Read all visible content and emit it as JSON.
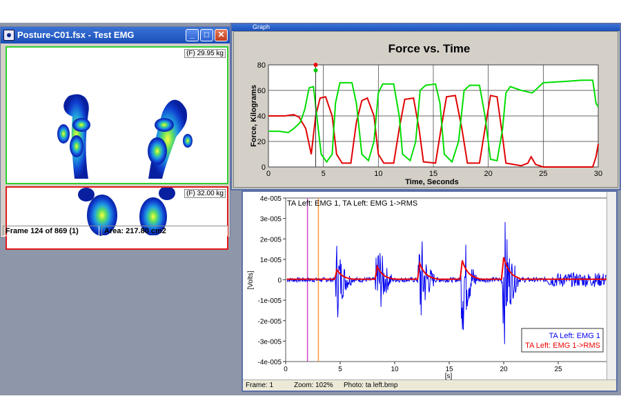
{
  "foot_window": {
    "title": "Posture-C01.fsx - Test  EMG",
    "minimize": "_",
    "maximize": "□",
    "close": "✕",
    "panel_top_label": "(F) 29.95 kg",
    "panel_bottom_label": "(F) 32.00 kg",
    "status_frame": "Frame 124 of 869 (1)",
    "status_area": "Area: 217.80 cm2"
  },
  "force_window": {
    "title": "Graph",
    "chart_data": {
      "type": "line",
      "title": "Force vs. Time",
      "xlabel": "Time, Seconds",
      "ylabel": "Force, Kilograms",
      "xlim": [
        0,
        30
      ],
      "ylim": [
        0,
        80
      ],
      "x_ticks": [
        "0",
        "5",
        "10",
        "15",
        "20",
        "25",
        "30"
      ],
      "y_ticks": [
        "0",
        "20",
        "40",
        "60",
        "80"
      ],
      "grid": true,
      "cursor_time": 4.3,
      "series": [
        {
          "color": "#e00000",
          "points": [
            [
              0,
              40
            ],
            [
              1.5,
              40
            ],
            [
              2.3,
              41
            ],
            [
              2.8,
              39
            ],
            [
              3.4,
              30
            ],
            [
              3.9,
              10
            ],
            [
              4.3,
              40
            ],
            [
              4.7,
              54
            ],
            [
              5.2,
              55
            ],
            [
              5.8,
              40
            ],
            [
              6.2,
              10
            ],
            [
              6.7,
              3
            ],
            [
              7.5,
              3
            ],
            [
              8,
              35
            ],
            [
              8.5,
              52
            ],
            [
              9,
              54
            ],
            [
              9.6,
              40
            ],
            [
              10,
              10
            ],
            [
              10.5,
              3
            ],
            [
              11.4,
              3
            ],
            [
              11.9,
              30
            ],
            [
              12.4,
              53
            ],
            [
              13.2,
              54
            ],
            [
              13.7,
              30
            ],
            [
              14.1,
              4
            ],
            [
              15.2,
              3
            ],
            [
              15.7,
              30
            ],
            [
              16.2,
              55
            ],
            [
              17,
              56
            ],
            [
              17.6,
              30
            ],
            [
              18.1,
              3
            ],
            [
              19.2,
              3
            ],
            [
              19.7,
              30
            ],
            [
              20.2,
              56
            ],
            [
              20.8,
              55
            ],
            [
              21.2,
              30
            ],
            [
              21.6,
              3
            ],
            [
              23,
              1
            ],
            [
              23.6,
              3
            ],
            [
              23.9,
              8
            ],
            [
              24.3,
              2
            ],
            [
              25,
              0
            ],
            [
              29.5,
              0
            ],
            [
              29.8,
              8
            ],
            [
              30,
              18
            ]
          ]
        },
        {
          "color": "#00dd00",
          "points": [
            [
              0,
              28
            ],
            [
              1,
              28
            ],
            [
              1.8,
              27
            ],
            [
              2.3,
              30
            ],
            [
              2.9,
              35
            ],
            [
              3.3,
              45
            ],
            [
              3.7,
              62
            ],
            [
              4.1,
              63
            ],
            [
              4.4,
              40
            ],
            [
              4.8,
              10
            ],
            [
              5.3,
              4
            ],
            [
              5.8,
              10
            ],
            [
              6.1,
              50
            ],
            [
              6.5,
              66
            ],
            [
              7.6,
              66
            ],
            [
              8,
              50
            ],
            [
              8.5,
              10
            ],
            [
              9.1,
              5
            ],
            [
              9.6,
              20
            ],
            [
              10,
              58
            ],
            [
              10.4,
              65
            ],
            [
              11.4,
              65
            ],
            [
              11.9,
              40
            ],
            [
              12.2,
              10
            ],
            [
              12.9,
              5
            ],
            [
              13.4,
              20
            ],
            [
              13.8,
              60
            ],
            [
              14.3,
              64
            ],
            [
              15.2,
              65
            ],
            [
              15.6,
              50
            ],
            [
              16,
              10
            ],
            [
              16.7,
              4
            ],
            [
              17.3,
              20
            ],
            [
              17.8,
              60
            ],
            [
              18.3,
              64
            ],
            [
              19.2,
              64
            ],
            [
              19.7,
              40
            ],
            [
              20.2,
              6
            ],
            [
              20.8,
              5
            ],
            [
              21.3,
              30
            ],
            [
              21.6,
              58
            ],
            [
              22,
              63
            ],
            [
              23,
              60
            ],
            [
              24,
              58
            ],
            [
              24.5,
              62
            ],
            [
              25,
              66
            ],
            [
              27,
              67
            ],
            [
              28.5,
              68
            ],
            [
              29.5,
              68
            ],
            [
              29.8,
              50
            ],
            [
              30,
              47
            ]
          ]
        }
      ]
    }
  },
  "emg_window": {
    "legend_top": "TA Left: EMG 1, TA Left: EMG 1->RMS",
    "ylabel": "[Volts]",
    "xlabel": "[s]",
    "x_ticks": [
      "0",
      "5",
      "10",
      "15",
      "20",
      "25",
      "30"
    ],
    "y_ticks": [
      "4e-005",
      "3e-005",
      "2e-005",
      "1e-005",
      "0",
      "-1e-005",
      "-2e-005",
      "-3e-005",
      "-4e-005"
    ],
    "legend": [
      {
        "label": "TA Left: EMG 1",
        "color": "#0000ee"
      },
      {
        "label": "TA Left: EMG 1->RMS",
        "color": "#ee0000"
      }
    ],
    "markers": [
      {
        "time": 2.0,
        "color": "#cc44cc"
      },
      {
        "time": 3.0,
        "color": "#ff9933"
      }
    ],
    "bursts_s": [
      4.7,
      8.4,
      12.3,
      16.2,
      20.0
    ],
    "status_frame": "Frame: 1",
    "status_zoom": "Zoom: 102%",
    "status_photo": "Photo: ta left.bmp"
  }
}
